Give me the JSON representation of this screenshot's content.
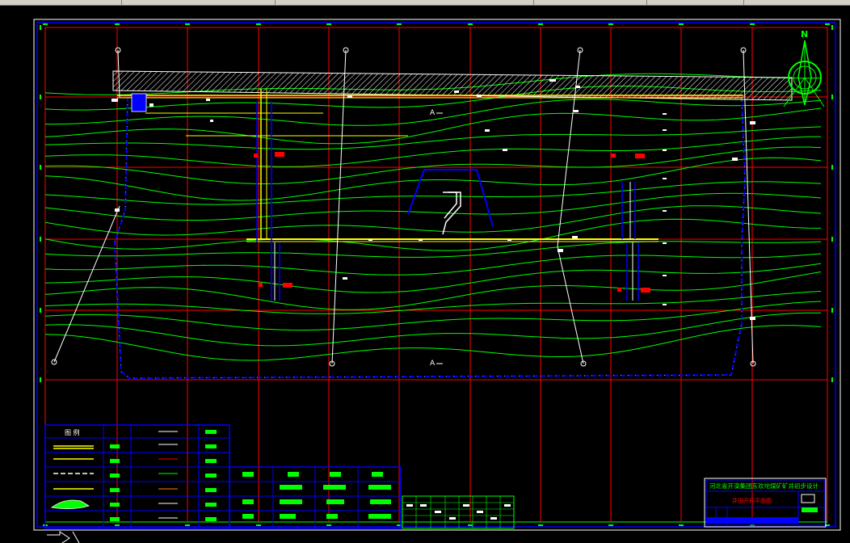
{
  "colors": {
    "background": "#000000",
    "grid": "#ff0000",
    "frame": "#0000ff",
    "contour": "#00ff00",
    "road": "#ffff00",
    "survey": "#ffffff",
    "boundary": "#0000ff"
  },
  "icons": {
    "compass": "north-arrow-icon",
    "ucs": "ucs-axis-icon"
  },
  "drawing": {
    "north_label": "N",
    "section_label_top": "A",
    "section_label_bottom": "A",
    "legend_title": "图 例",
    "title_block": {
      "project_title": "河北省开滦集团东欢坨煤矿矿井初步设计",
      "drawing_title": "井田开拓平面图"
    }
  }
}
